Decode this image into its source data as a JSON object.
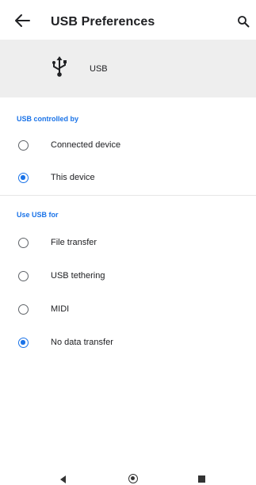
{
  "appbar": {
    "title": "USB Preferences",
    "back_icon": "arrow-back-icon",
    "search_icon": "search-icon"
  },
  "banner": {
    "icon": "usb-icon",
    "label": "USB"
  },
  "sections": {
    "controlled_by": {
      "header": "USB controlled by",
      "options": [
        {
          "label": "Connected device",
          "selected": false
        },
        {
          "label": "This device",
          "selected": true
        }
      ]
    },
    "use_for": {
      "header": "Use USB for",
      "options": [
        {
          "label": "File transfer",
          "selected": false
        },
        {
          "label": "USB tethering",
          "selected": false
        },
        {
          "label": "MIDI",
          "selected": false
        },
        {
          "label": "No data transfer",
          "selected": true
        }
      ]
    }
  },
  "colors": {
    "accent": "#1a73e8",
    "banner_bg": "#eeeeee",
    "text": "#202124"
  },
  "navbar": {
    "back_icon": "nav-back-icon",
    "home_icon": "nav-home-icon",
    "recents_icon": "nav-recents-icon"
  }
}
